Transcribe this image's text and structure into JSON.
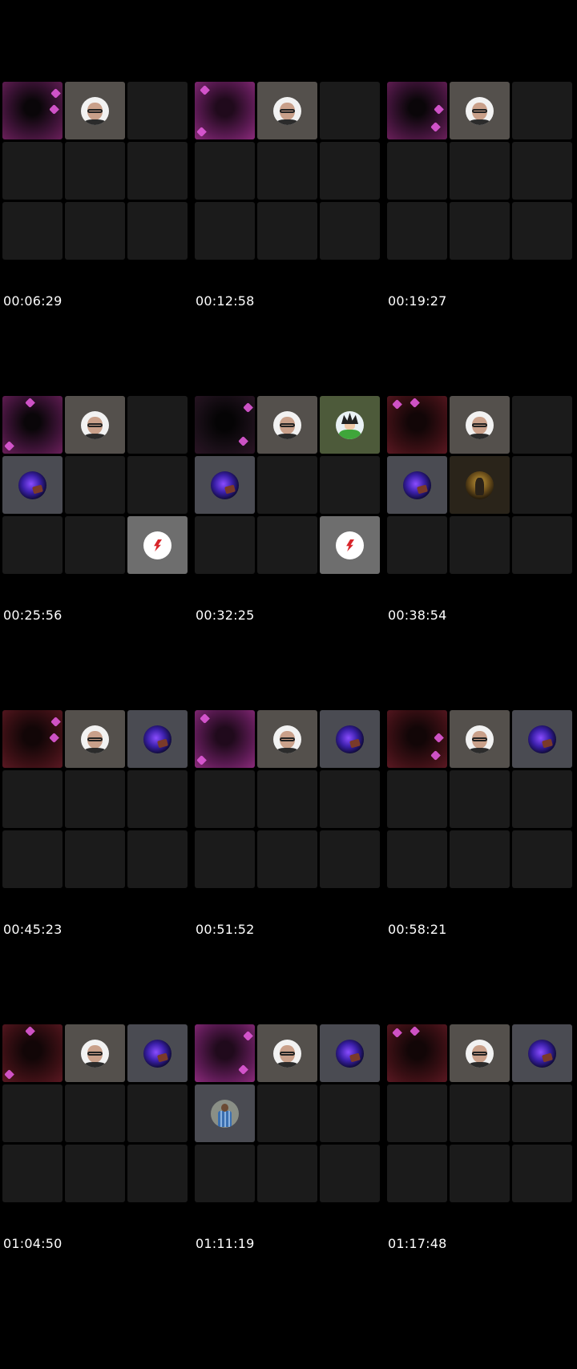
{
  "thumbnails": [
    {
      "timestamp": "00:06:29",
      "tiles": [
        "video-pink",
        "man",
        "empty",
        "empty",
        "empty",
        "empty",
        "empty",
        "empty",
        "empty"
      ]
    },
    {
      "timestamp": "00:12:58",
      "tiles": [
        "video-magenta",
        "man",
        "empty",
        "empty",
        "empty",
        "empty",
        "empty",
        "empty",
        "empty"
      ]
    },
    {
      "timestamp": "00:19:27",
      "tiles": [
        "video-pink",
        "man",
        "empty",
        "empty",
        "empty",
        "empty",
        "empty",
        "empty",
        "empty"
      ]
    },
    {
      "timestamp": "00:25:56",
      "tiles": [
        "video-pink",
        "man",
        "empty",
        "cosmic",
        "empty",
        "empty",
        "empty",
        "empty",
        "bolt"
      ]
    },
    {
      "timestamp": "00:32:25",
      "tiles": [
        "video-dark",
        "man",
        "anime",
        "cosmic",
        "empty",
        "empty",
        "empty",
        "empty",
        "bolt"
      ]
    },
    {
      "timestamp": "00:38:54",
      "tiles": [
        "video-red",
        "man",
        "empty",
        "cosmic",
        "gold",
        "empty",
        "empty",
        "empty",
        "empty"
      ]
    },
    {
      "timestamp": "00:45:23",
      "tiles": [
        "video-red",
        "man",
        "cosmic",
        "empty",
        "empty",
        "empty",
        "empty",
        "empty",
        "empty"
      ]
    },
    {
      "timestamp": "00:51:52",
      "tiles": [
        "video-magenta",
        "man",
        "cosmic",
        "empty",
        "empty",
        "empty",
        "empty",
        "empty",
        "empty"
      ]
    },
    {
      "timestamp": "00:58:21",
      "tiles": [
        "video-red",
        "man",
        "cosmic",
        "empty",
        "empty",
        "empty",
        "empty",
        "empty",
        "empty"
      ]
    },
    {
      "timestamp": "01:04:50",
      "tiles": [
        "video-red",
        "man",
        "cosmic",
        "empty",
        "empty",
        "empty",
        "empty",
        "empty",
        "empty"
      ]
    },
    {
      "timestamp": "01:11:19",
      "tiles": [
        "video-magenta",
        "man",
        "cosmic",
        "person",
        "empty",
        "empty",
        "empty",
        "empty",
        "empty"
      ]
    },
    {
      "timestamp": "01:17:48",
      "tiles": [
        "video-red",
        "man",
        "cosmic",
        "empty",
        "empty",
        "empty",
        "empty",
        "empty",
        "empty"
      ]
    }
  ],
  "colors": {
    "background": "#000000",
    "tile_empty": "#1b1b1b",
    "heart": "#e05ad8",
    "timestamp_text": "#ffffff"
  },
  "icons": {
    "man": "man-with-glasses-avatar-icon",
    "cosmic": "cosmic-planet-avatar-icon",
    "anime": "anime-character-avatar-icon",
    "bolt": "lightning-bolt-logo-icon",
    "gold": "gold-figure-avatar-icon",
    "person": "person-photo-avatar-icon"
  }
}
